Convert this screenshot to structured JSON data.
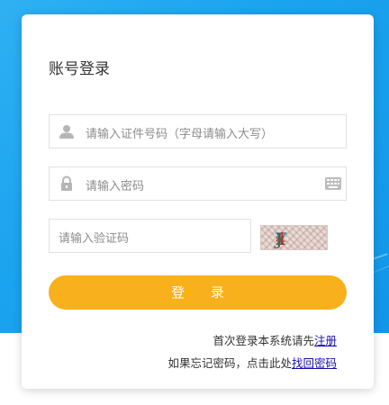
{
  "login": {
    "title": "账号登录",
    "username_placeholder": "请输入证件号码（字母请输入大写）",
    "password_placeholder": "请输入密码",
    "captcha_placeholder": "请输入验证码",
    "captcha_text": [
      "J",
      "Y",
      "z",
      "4"
    ],
    "submit_label": "登 录",
    "first_login_text": "首次登录本系统请先",
    "register_link": "注册",
    "forgot_text": "如果忘记密码，点击此处",
    "recover_link": "找回密码"
  },
  "colors": {
    "background_blue": "#1aa3ee",
    "button_orange": "#f8b01c",
    "link_blue": "#1a0dab"
  },
  "icons": {
    "username": "user-icon",
    "password": "lock-icon",
    "keyboard": "keyboard-icon"
  }
}
